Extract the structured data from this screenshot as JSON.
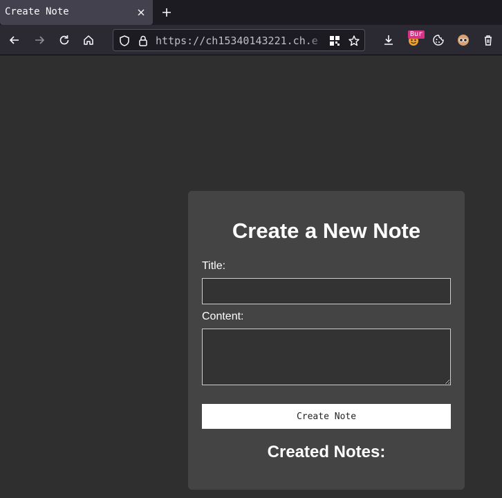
{
  "browser": {
    "tab": {
      "title": "Create Note"
    },
    "url": "https://ch15340143221.ch.e",
    "extension_badge": "Bur",
    "icons": {
      "tab_close": "close-icon",
      "new_tab": "plus-icon",
      "back": "arrow-left-icon",
      "forward": "arrow-right-icon",
      "reload": "reload-icon",
      "home": "home-icon",
      "tracking": "shield-icon",
      "security": "lock-icon",
      "qr": "qr-code-icon",
      "bookmark": "star-icon",
      "downloads": "download-icon",
      "extensions": [
        "burp-extension-icon",
        "cookie-icon",
        "glasses-icon",
        "trash-icon"
      ]
    }
  },
  "page": {
    "heading": "Create a New Note",
    "form": {
      "title_label": "Title:",
      "title_value": "",
      "content_label": "Content:",
      "content_value": "",
      "submit_label": "Create Note"
    },
    "notes_heading": "Created Notes:",
    "notes": []
  },
  "colors": {
    "page_background": "#2f2f2f",
    "card_background": "#444444",
    "input_background": "#333333",
    "button_background": "#ffffff",
    "text": "#ffffff",
    "chrome_background": "#2b2a33",
    "badge": "#d63384"
  }
}
